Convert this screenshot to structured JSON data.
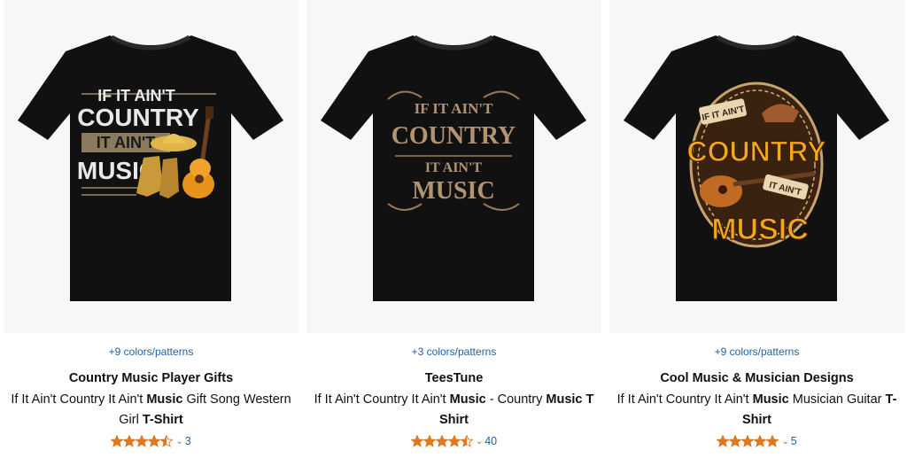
{
  "products": [
    {
      "colors": "+9 colors/patterns",
      "brand": "Country Music Player Gifts",
      "title_pre": "If It Ain't Country It Ain't ",
      "title_bold1": "Music",
      "title_mid": " Gift Song Western Girl ",
      "title_bold2": "T-Shirt",
      "stars": 4.5,
      "review_count": "3",
      "print_text": [
        "IF IT AIN'T",
        "COUNTRY",
        "IT AIN'T",
        "MUSIC"
      ]
    },
    {
      "colors": "+3 colors/patterns",
      "brand": "TeesTune",
      "title_pre": "If It Ain't Country It Ain't ",
      "title_bold1": "Music",
      "title_mid": " - Country ",
      "title_bold2": "Music T Shirt",
      "stars": 4.5,
      "review_count": "40",
      "print_text": [
        "IF IT AIN'T",
        "COUNTRY",
        "IT AIN'T",
        "MUSIC"
      ]
    },
    {
      "colors": "+9 colors/patterns",
      "brand": "Cool Music & Musician Designs",
      "title_pre": "If It Ain't Country It Ain't ",
      "title_bold1": "Music",
      "title_mid": " Musician Guitar ",
      "title_bold2": "T-Shirt",
      "stars": 5,
      "review_count": "5",
      "print_text": [
        "IF IT AIN'T",
        "COUNTRY",
        "IT AIN'T",
        "MUSIC"
      ]
    }
  ],
  "colors": {
    "link": "#2162a1",
    "star": "#de7921",
    "shirt": "#111111",
    "image_bg": "#f7f7f7"
  }
}
